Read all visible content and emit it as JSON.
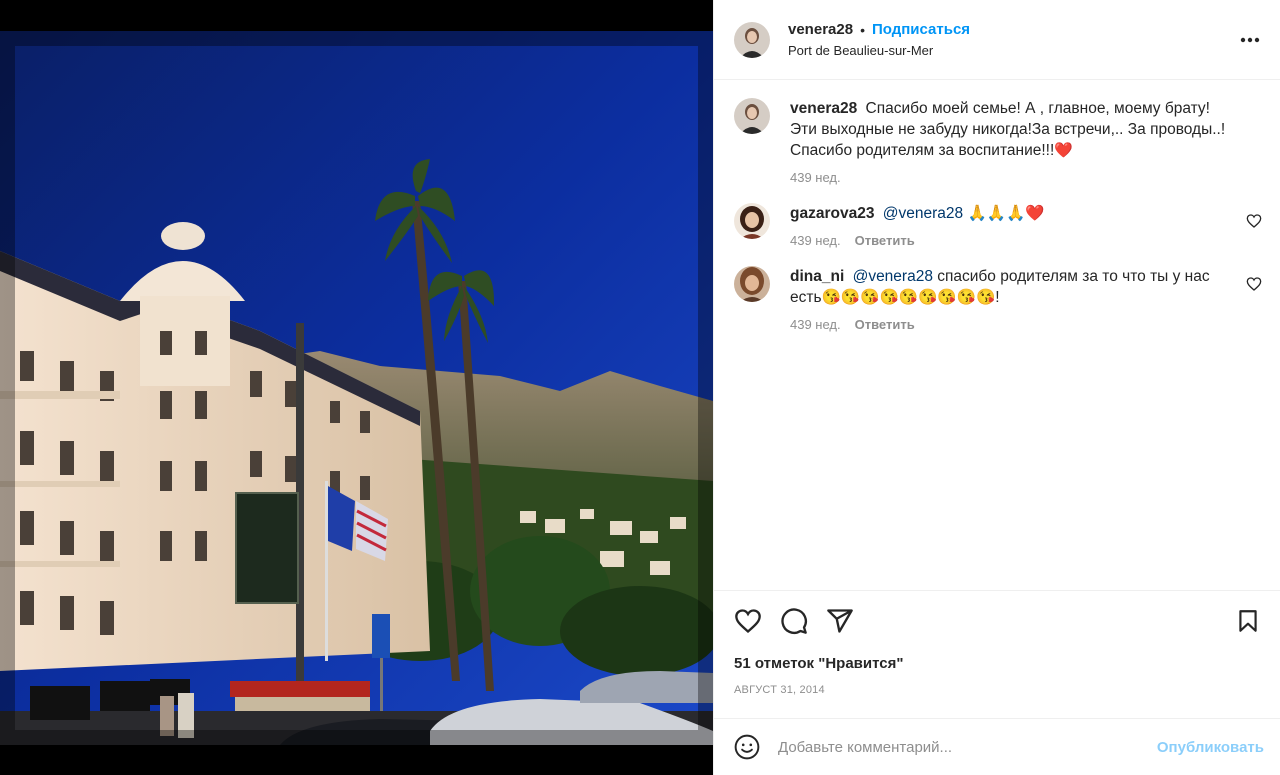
{
  "post": {
    "author": "venera28",
    "separator": "•",
    "follow_label": "Подписаться",
    "location": "Port de Beaulieu-sur-Mer",
    "more_icon": "more-horizontal-icon"
  },
  "caption": {
    "user": "venera28",
    "text": "Спасибо моей семье! А , главное, моему брату! Эти выходные не забуду никогда!За встречи,.. За проводы..! Спасибо родителям за воспитание!!!",
    "emoji": "❤️",
    "time": "439 нед."
  },
  "comments": [
    {
      "user": "gazarova23",
      "mention": "@venera28",
      "text": " 🙏🙏🙏❤️",
      "time": "439 нед.",
      "reply_label": "Ответить"
    },
    {
      "user": "dina_ni",
      "mention": "@venera28",
      "text": " спасибо родителям за то что ты у нас есть😘😘😘😘😘😘😘😘😘!",
      "time": "439 нед.",
      "reply_label": "Ответить"
    }
  ],
  "actions": {
    "icons": [
      "heart-icon",
      "comment-icon",
      "share-icon",
      "bookmark-icon"
    ],
    "likes": "51 отметок \"Нравится\"",
    "date": "АВГУСТ 31, 2014"
  },
  "add_comment": {
    "placeholder": "Добавьте комментарий...",
    "publish_label": "Опубликовать"
  },
  "colors": {
    "accent": "#0095f6",
    "muted": "#8e8e8e",
    "text": "#262626",
    "mention": "#00376b"
  }
}
